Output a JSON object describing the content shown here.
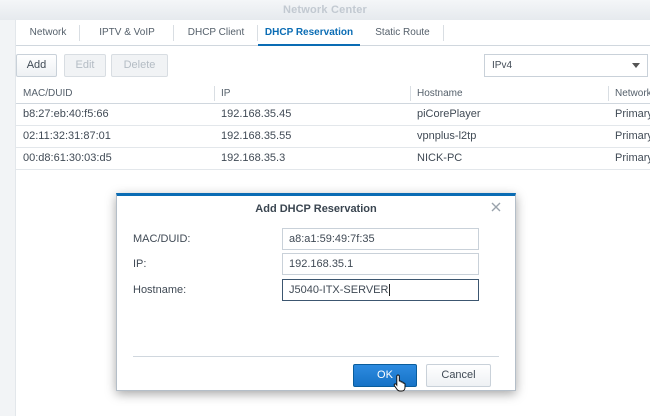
{
  "window": {
    "title": "Network Center"
  },
  "tabs": [
    {
      "label": "Network"
    },
    {
      "label": "IPTV & VoIP"
    },
    {
      "label": "DHCP Client"
    },
    {
      "label": "DHCP Reservation"
    },
    {
      "label": "Static Route"
    }
  ],
  "toolbar": {
    "add_label": "Add",
    "edit_label": "Edit",
    "delete_label": "Delete"
  },
  "ip_version_select": {
    "value": "IPv4"
  },
  "table": {
    "columns": [
      "MAC/DUID",
      "IP",
      "Hostname",
      "Network"
    ],
    "rows": [
      {
        "mac": "b8:27:eb:40:f5:66",
        "ip": "192.168.35.45",
        "hostname": "piCorePlayer",
        "network": "Primary"
      },
      {
        "mac": "02:11:32:31:87:01",
        "ip": "192.168.35.55",
        "hostname": "vpnplus-l2tp",
        "network": "Primary"
      },
      {
        "mac": "00:d8:61:30:03:d5",
        "ip": "192.168.35.3",
        "hostname": "NICK-PC",
        "network": "Primary"
      }
    ]
  },
  "dialog": {
    "title": "Add DHCP Reservation",
    "close_icon": "close-icon",
    "fields": {
      "mac_label": "MAC/DUID:",
      "mac_value": "a8:a1:59:49:7f:35",
      "ip_label": "IP:",
      "ip_value": "192.168.35.1",
      "hostname_label": "Hostname:",
      "hostname_value": "J5040-ITX-SERVER"
    },
    "ok_label": "OK",
    "cancel_label": "Cancel"
  },
  "colors": {
    "accent": "#0a6cb4",
    "ok_button": "#1672c6"
  }
}
